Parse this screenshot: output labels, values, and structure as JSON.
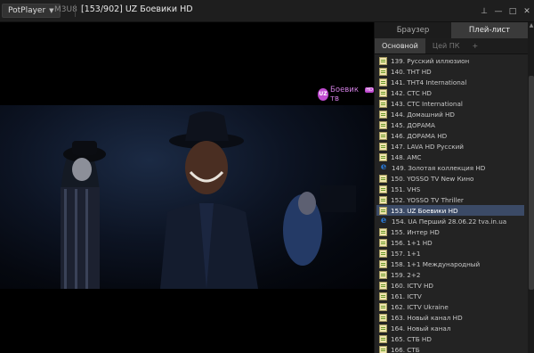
{
  "titlebar": {
    "app_name": "PotPlayer",
    "format": "M3U8",
    "title": "[153/902] UZ Боевики HD",
    "buttons": {
      "pin": "⊥",
      "minimize": "—",
      "maximize": "□",
      "close": "✕"
    }
  },
  "video": {
    "channel_logo": "Боевик тв",
    "logo_mark": "UZ",
    "logo_mini": "HD"
  },
  "panel": {
    "tabs": [
      "Браузер",
      "Плей-лист"
    ],
    "active_tab": 1,
    "subtabs": [
      "Основной",
      "Цей ПК",
      "+"
    ],
    "active_subtab": 0,
    "selected_index": 14,
    "items": [
      {
        "label": "139. Русский иллюзион",
        "icon": "playlist-file-icon"
      },
      {
        "label": "140. ТНТ HD",
        "icon": "playlist-file-icon"
      },
      {
        "label": "141. ТНТ4 International",
        "icon": "playlist-file-icon"
      },
      {
        "label": "142. СТС HD",
        "icon": "playlist-file-icon"
      },
      {
        "label": "143. СТС International",
        "icon": "playlist-file-icon"
      },
      {
        "label": "144. Домашний HD",
        "icon": "playlist-file-icon"
      },
      {
        "label": "145. ДОРАМА",
        "icon": "playlist-file-icon"
      },
      {
        "label": "146. ДОРАМА HD",
        "icon": "playlist-file-icon"
      },
      {
        "label": "147. LAVA HD Русский",
        "icon": "playlist-file-icon"
      },
      {
        "label": "148. AMC",
        "icon": "playlist-file-icon"
      },
      {
        "label": "149. Золотая коллекция HD",
        "icon": "browser-e-icon"
      },
      {
        "label": "150. YOSSO TV New Кино",
        "icon": "playlist-file-icon"
      },
      {
        "label": "151. VHS",
        "icon": "playlist-file-icon"
      },
      {
        "label": "152. YOSSO TV Thriller",
        "icon": "playlist-file-icon"
      },
      {
        "label": "153. UZ Боевики HD",
        "icon": "playlist-file-icon"
      },
      {
        "label": "154. UA Перший 28.06.22 tva.in.ua",
        "icon": "browser-e-icon"
      },
      {
        "label": "155. Интер HD",
        "icon": "playlist-file-icon"
      },
      {
        "label": "156. 1+1 HD",
        "icon": "playlist-file-icon"
      },
      {
        "label": "157. 1+1",
        "icon": "playlist-file-icon"
      },
      {
        "label": "158. 1+1 Международный",
        "icon": "playlist-file-icon"
      },
      {
        "label": "159. 2+2",
        "icon": "playlist-file-icon"
      },
      {
        "label": "160. ICTV HD",
        "icon": "playlist-file-icon"
      },
      {
        "label": "161. ICTV",
        "icon": "playlist-file-icon"
      },
      {
        "label": "162. ICTV Ukraine",
        "icon": "playlist-file-icon"
      },
      {
        "label": "163. Новый канал HD",
        "icon": "playlist-file-icon"
      },
      {
        "label": "164. Новый канал",
        "icon": "playlist-file-icon"
      },
      {
        "label": "165. СТБ HD",
        "icon": "playlist-file-icon"
      },
      {
        "label": "166. СТБ",
        "icon": "playlist-file-icon"
      }
    ]
  },
  "colors": {
    "selection": "#3b4a66",
    "logo": "#c04ad0",
    "panel_bg": "#232323"
  }
}
